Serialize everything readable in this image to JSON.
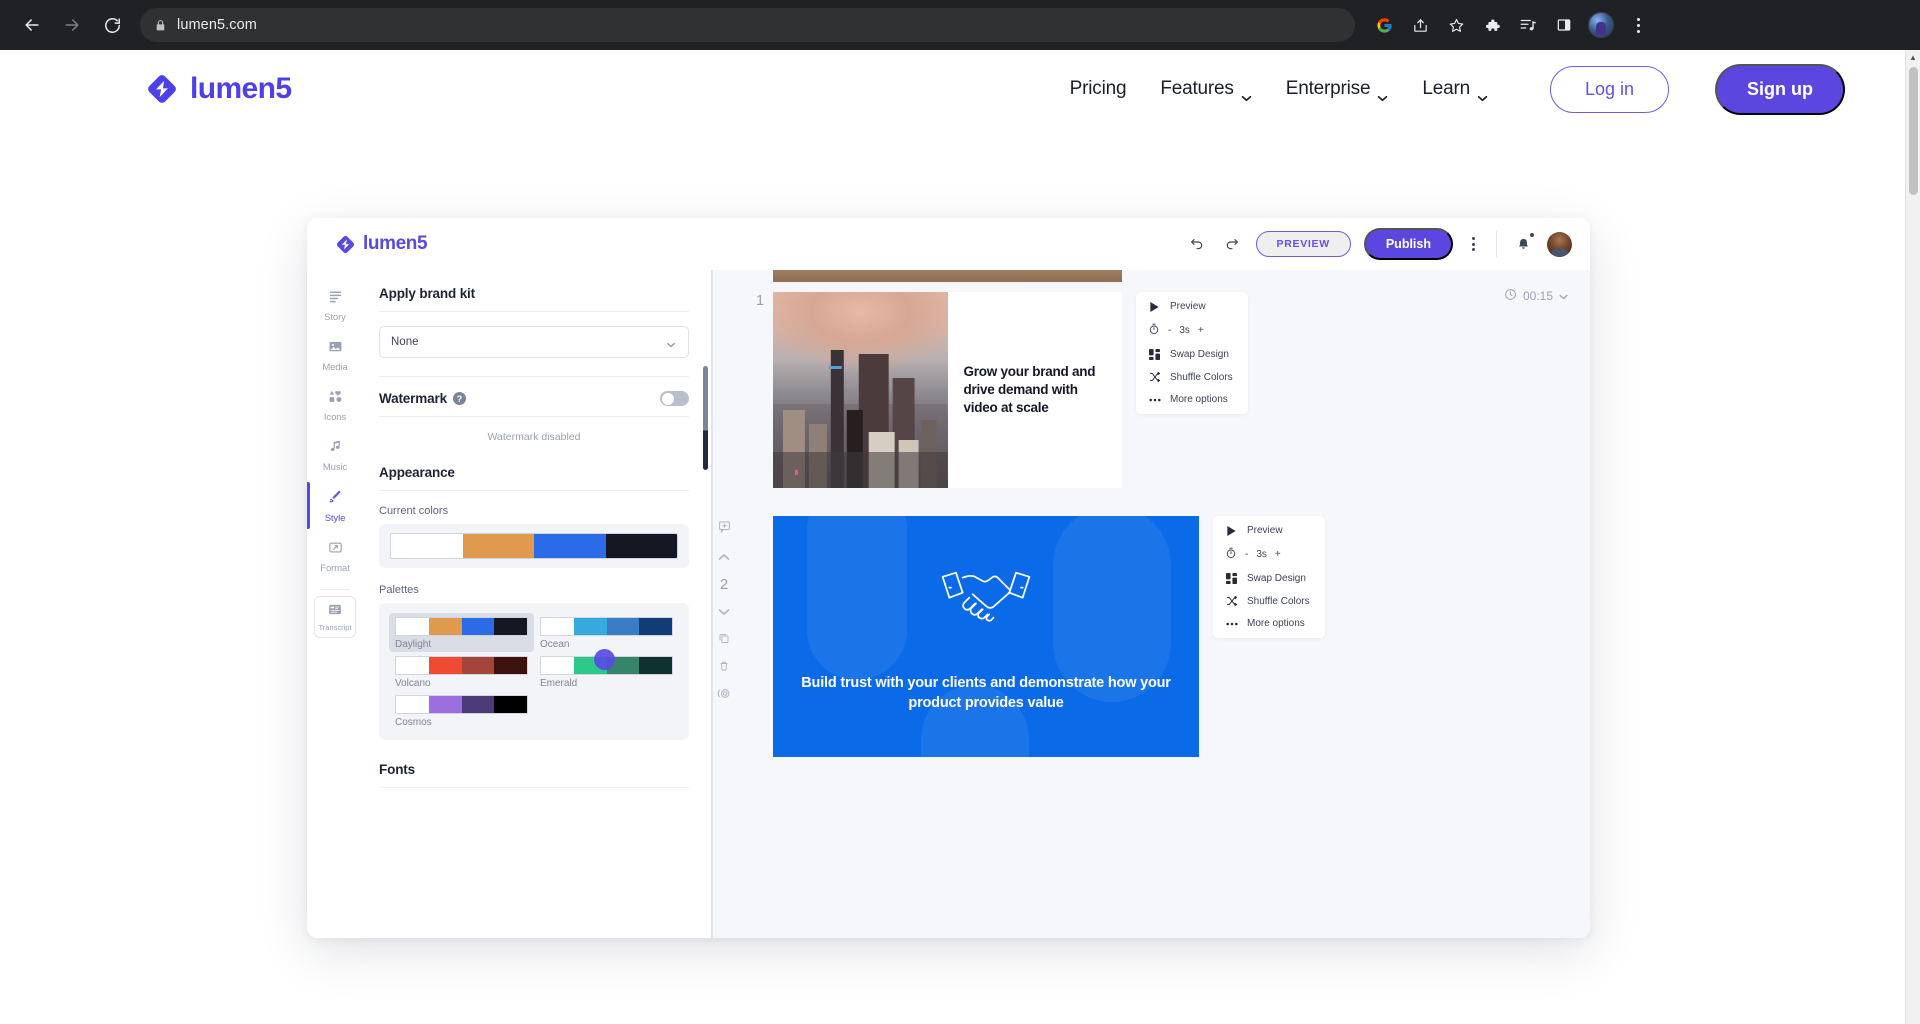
{
  "browser": {
    "url": "lumen5.com",
    "back_icon": "back-arrow-icon",
    "forward_icon": "forward-arrow-icon",
    "reload_icon": "reload-icon",
    "lock_icon": "lock-icon",
    "right_icons": [
      "google-icon",
      "share-icon",
      "bookmark-star-icon",
      "extensions-puzzle-icon",
      "reading-list-icon",
      "side-panel-icon",
      "profile-avatar",
      "chrome-menu-icon"
    ]
  },
  "site": {
    "brand": "lumen5",
    "nav": [
      {
        "label": "Pricing",
        "has_chevron": false
      },
      {
        "label": "Features",
        "has_chevron": true
      },
      {
        "label": "Enterprise",
        "has_chevron": true
      },
      {
        "label": "Learn",
        "has_chevron": true
      }
    ],
    "login_label": "Log in",
    "signup_label": "Sign up",
    "accent": "#5b47e0"
  },
  "app": {
    "brand": "lumen5",
    "toolbar": {
      "undo_icon": "undo-icon",
      "redo_icon": "redo-icon",
      "preview_label": "PREVIEW",
      "publish_label": "Publish",
      "more_icon": "kebab-menu-icon",
      "bell_icon": "notifications-bell-icon",
      "avatar": "user-avatar"
    },
    "rail": [
      {
        "label": "Story",
        "icon": "story-lines-icon",
        "active": false
      },
      {
        "label": "Media",
        "icon": "media-image-icon",
        "active": false
      },
      {
        "label": "Icons",
        "icon": "icons-shapes-icon",
        "active": false
      },
      {
        "label": "Music",
        "icon": "music-note-icon",
        "active": false
      },
      {
        "label": "Style",
        "icon": "style-palette-icon",
        "active": true
      },
      {
        "label": "Format",
        "icon": "format-frame-icon",
        "active": false
      }
    ],
    "rail_boxed": {
      "label": "Transcript",
      "icon": "transcript-icon"
    },
    "panel": {
      "brand_kit_title": "Apply brand kit",
      "brand_kit_value": "None",
      "watermark_label": "Watermark",
      "watermark_help": "?",
      "watermark_status": "Watermark disabled",
      "watermark_on": false,
      "appearance_title": "Appearance",
      "current_colors_label": "Current colors",
      "current_colors": [
        "#ffffff",
        "#e09a4e",
        "#2b6be8",
        "#141824"
      ],
      "palettes_label": "Palettes",
      "palettes": [
        {
          "name": "Daylight",
          "colors": [
            "#ffffff",
            "#e09a4e",
            "#2b6be8",
            "#141824"
          ],
          "selected": true
        },
        {
          "name": "Ocean",
          "colors": [
            "#ffffff",
            "#36a9dd",
            "#3a7dc4",
            "#123c77"
          ],
          "selected": false
        },
        {
          "name": "Volcano",
          "colors": [
            "#ffffff",
            "#ef4b33",
            "#a34539",
            "#3d120c"
          ],
          "selected": false
        },
        {
          "name": "Emerald",
          "colors": [
            "#ffffff",
            "#2ec98a",
            "#36846a",
            "#0f3230"
          ],
          "selected": false
        },
        {
          "name": "Cosmos",
          "colors": [
            "#ffffff",
            "#9b6fe0",
            "#4b3a77",
            "#000000"
          ],
          "selected": false
        }
      ],
      "fonts_label": "Fonts"
    },
    "canvas": {
      "duration": "00:15",
      "clock_icon": "clock-icon",
      "scenes": [
        {
          "number": "1",
          "text": "Grow your brand and drive demand with video at scale",
          "type": "image-text"
        },
        {
          "number": "2",
          "text": "Build trust with your clients and demonstrate how your product provides value",
          "type": "blue-icon"
        }
      ],
      "scene_options": [
        {
          "label": "Preview",
          "icon": "play-icon"
        },
        {
          "label": "Swap Design",
          "icon": "grid-icon"
        },
        {
          "label": "Shuffle Colors",
          "icon": "shuffle-icon"
        },
        {
          "label": "More options",
          "icon": "ellipsis-icon"
        }
      ],
      "timer": {
        "minus": "-",
        "value": "3s",
        "plus": "+",
        "icon": "stopwatch-icon"
      },
      "scene_tools": [
        "add-scene-icon",
        "move-up-icon",
        "move-down-icon",
        "duplicate-icon",
        "delete-icon",
        "focus-icon"
      ]
    }
  }
}
